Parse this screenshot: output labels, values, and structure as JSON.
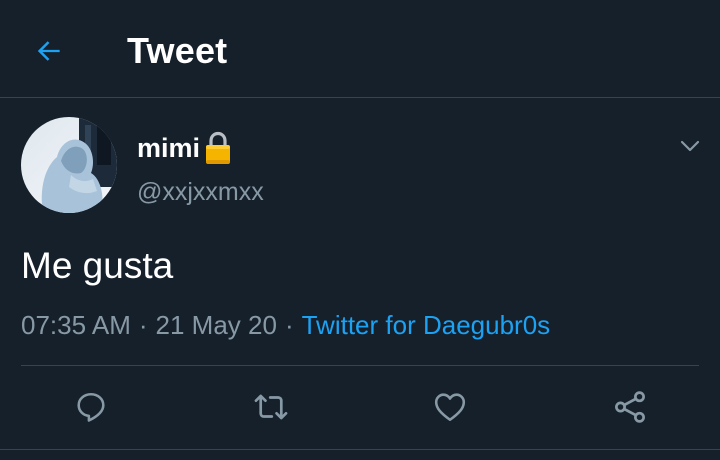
{
  "header": {
    "title": "Tweet",
    "back_icon": "arrow-left-icon"
  },
  "tweet": {
    "author": {
      "display_name": "mimi",
      "handle": "@xxjxxmxx",
      "protected_icon": "lock-icon"
    },
    "text": "Me gusta",
    "time": "07:35 AM",
    "separator": "·",
    "date": "21 May 20",
    "source": "Twitter for Daegubr0s"
  },
  "actions": [
    {
      "name": "reply",
      "icon": "reply-icon"
    },
    {
      "name": "retweet",
      "icon": "retweet-icon"
    },
    {
      "name": "like",
      "icon": "heart-icon"
    },
    {
      "name": "share",
      "icon": "share-icon"
    }
  ],
  "colors": {
    "background": "#15202b",
    "accent": "#1da1f2",
    "secondary_text": "#8899a6",
    "divider": "#38444d",
    "lock": "#f4b400"
  }
}
